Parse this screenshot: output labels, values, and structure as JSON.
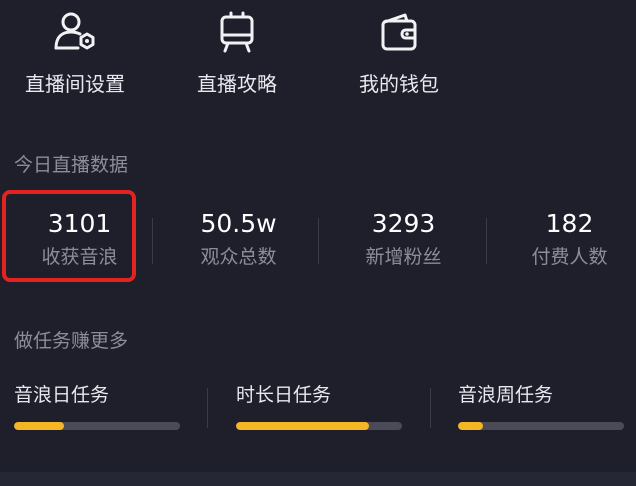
{
  "shortcuts": [
    {
      "label": "直播间设置",
      "icon": "user-settings-icon"
    },
    {
      "label": "直播攻略",
      "icon": "guide-board-icon"
    },
    {
      "label": "我的钱包",
      "icon": "wallet-icon"
    }
  ],
  "today_stats": {
    "title": "今日直播数据",
    "items": [
      {
        "value": "3101",
        "label": "收获音浪"
      },
      {
        "value": "50.5w",
        "label": "观众总数"
      },
      {
        "value": "3293",
        "label": "新增粉丝"
      },
      {
        "value": "182",
        "label": "付费人数"
      }
    ]
  },
  "tasks": {
    "title": "做任务赚更多",
    "items": [
      {
        "label": "音浪日任务",
        "progress": 0.3
      },
      {
        "label": "时长日任务",
        "progress": 0.8
      },
      {
        "label": "音浪周任务",
        "progress": 0.15
      }
    ]
  },
  "colors": {
    "background": "#1e1f2b",
    "accent": "#f5b626",
    "highlight": "#e3231f",
    "track": "#4a4b57"
  }
}
